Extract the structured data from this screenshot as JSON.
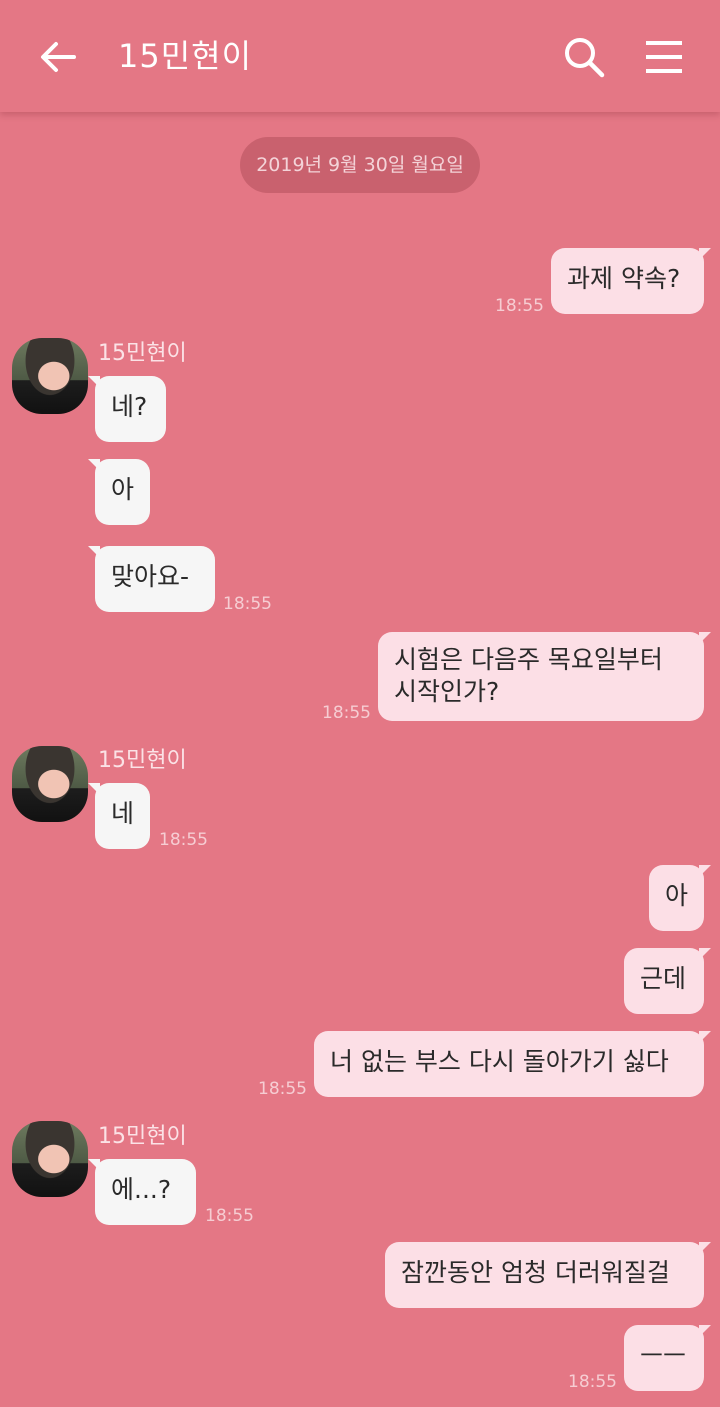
{
  "header": {
    "title": "15민현이"
  },
  "date_divider": "2019년 9월 30일 월요일",
  "sender_name": "15민현이",
  "messages": [
    {
      "text": "과제 약속?",
      "time": "18:55"
    },
    {
      "text": "네?"
    },
    {
      "text": "아"
    },
    {
      "text": "맞아요-",
      "time": "18:55"
    },
    {
      "line1": "시험은 다음주 목요일부터",
      "line2": "시작인가?",
      "time": "18:55"
    },
    {
      "text": "네",
      "time": "18:55"
    },
    {
      "text": "아"
    },
    {
      "text": "근데"
    },
    {
      "text": "너 없는 부스 다시 돌아가기 싫다",
      "time": "18:55"
    },
    {
      "text": "에...?",
      "time": "18:55"
    },
    {
      "text": "잠깐동안 엄청 더러워질걸"
    },
    {
      "text": "ㅡㅡ",
      "time": "18:55"
    }
  ],
  "colors": {
    "background": "#e47785",
    "my_bubble": "#fcdfe6",
    "their_bubble": "#f6f6f6",
    "date_pill": "#c9616e"
  },
  "icons": [
    "back-arrow-icon",
    "search-icon",
    "menu-icon"
  ]
}
